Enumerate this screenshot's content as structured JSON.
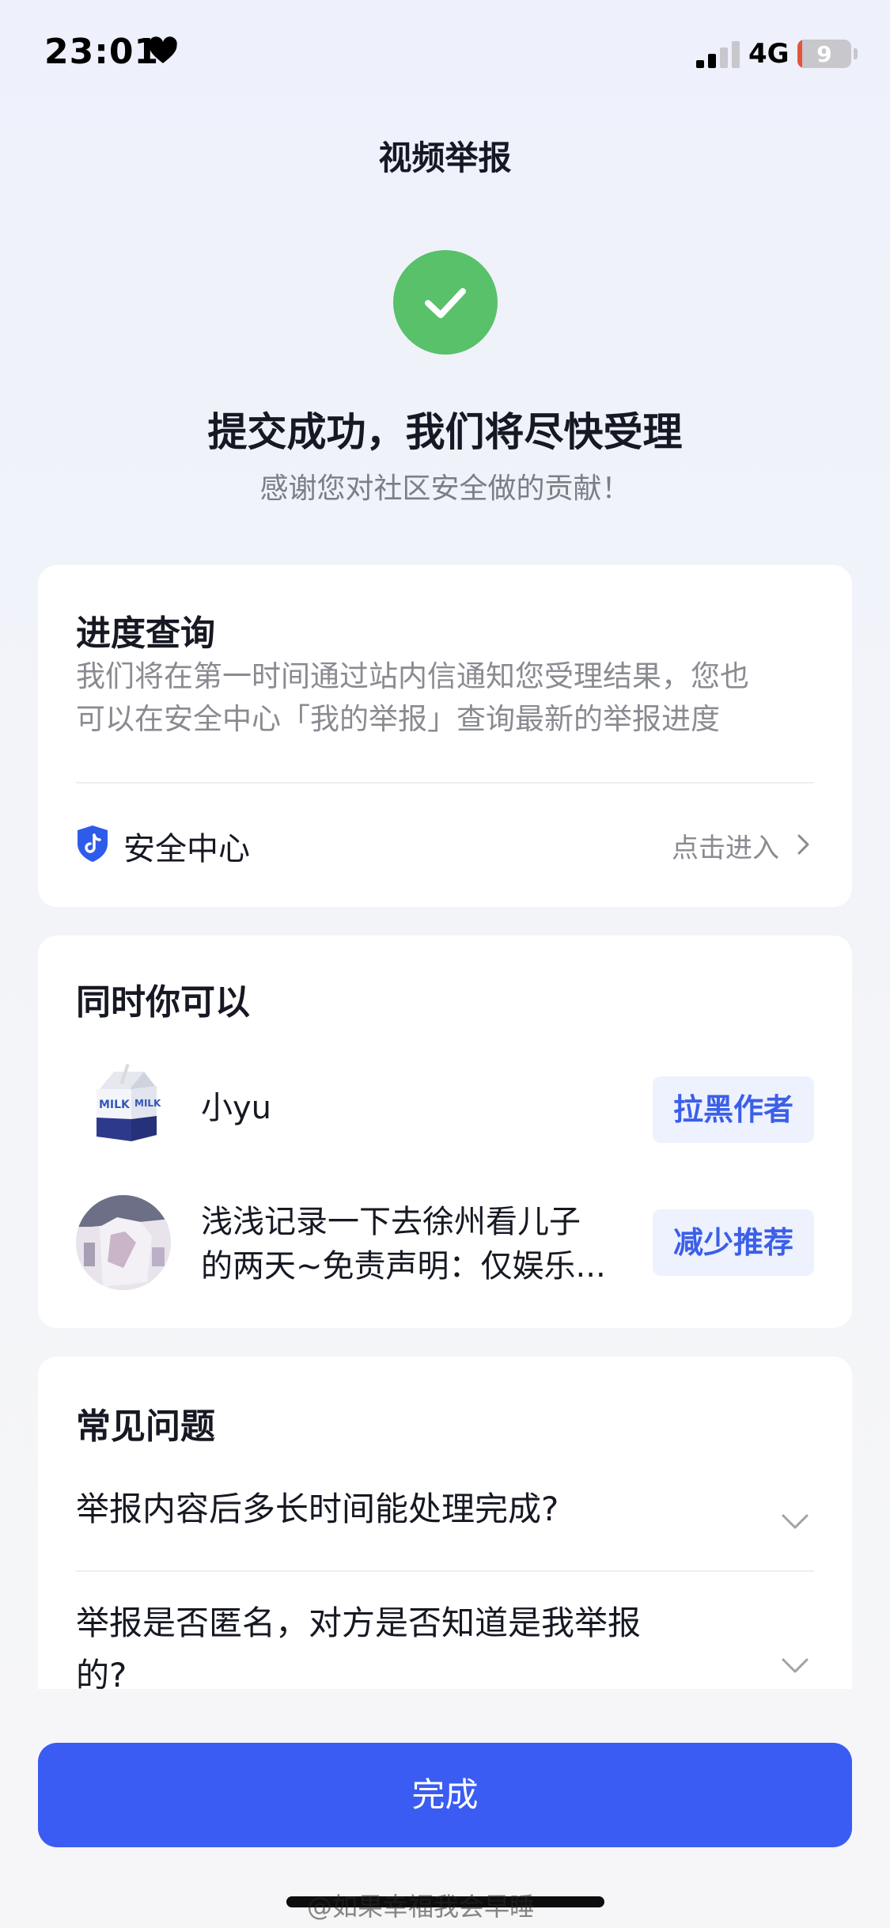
{
  "status_bar": {
    "time": "23:01",
    "network": "4G",
    "battery": "9",
    "battery_level": 0.09
  },
  "header": {
    "title": "视频举报"
  },
  "success": {
    "title": "提交成功，我们将尽快受理",
    "subtitle": "感谢您对社区安全做的贡献！"
  },
  "progress_card": {
    "title": "进度查询",
    "description_line1": "我们将在第一时间通过站内信通知您受理结果，您也",
    "description_line2": "可以在安全中心「我的举报」查询最新的举报进度",
    "security_center_label": "安全中心",
    "enter_label": "点击进入"
  },
  "actions_card": {
    "title": "同时你可以",
    "items": [
      {
        "text": "小yu",
        "button": "拉黑作者"
      },
      {
        "text_line1": "浅浅记录一下去徐州看儿子",
        "text_line2": "的两天~免责声明：仅娱乐...",
        "button": "减少推荐"
      }
    ]
  },
  "faq_card": {
    "title": "常见问题",
    "questions": [
      {
        "line1": "举报内容后多长时间能处理完成?"
      },
      {
        "line1": "举报是否匿名，对方是否知道是我举报",
        "line2": "的?"
      }
    ]
  },
  "footer": {
    "done_label": "完成",
    "watermark": "@如果幸福我会早睡"
  },
  "colors": {
    "accent": "#3a5cf3",
    "success": "#58c16a",
    "link_bg": "#eef1fe",
    "link_text": "#3b5fe8"
  }
}
